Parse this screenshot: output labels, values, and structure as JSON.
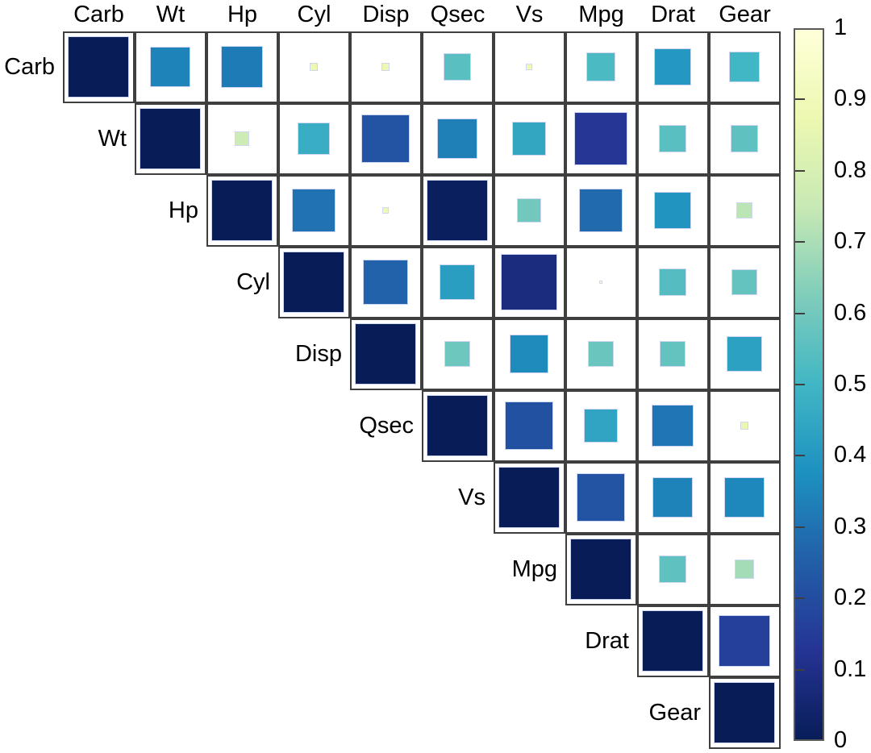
{
  "figure": {
    "type": "correlation-matrix-heatmap",
    "background": "#ffffff",
    "grid_line_color": "#3f3f3f",
    "square_border_color": "#ced7ef"
  },
  "chart_data": {
    "type": "heatmap",
    "title": "",
    "xlabel": "",
    "ylabel": "",
    "colormap": "YlGnBu",
    "colorbar": {
      "min": 0,
      "max": 1,
      "orientation": "vertical",
      "position": "right",
      "ticks": [
        1,
        0.9,
        0.8,
        0.7,
        0.6,
        0.5,
        0.4,
        0.3,
        0.2,
        0.1,
        0
      ],
      "tick_labels": [
        "1",
        "0.9",
        "0.8",
        "0.7",
        "0.6",
        "0.5",
        "0.4",
        "0.3",
        "0.2",
        "0.1",
        "0"
      ]
    },
    "layout": "upper-triangular",
    "marker": "square-sized-by-value",
    "categories": [
      "Carb",
      "Wt",
      "Hp",
      "Cyl",
      "Disp",
      "Qsec",
      "Vs",
      "Mpg",
      "Drat",
      "Gear"
    ],
    "xtick_labels": [
      "Carb",
      "Wt",
      "Hp",
      "Cyl",
      "Disp",
      "Qsec",
      "Vs",
      "Mpg",
      "Drat",
      "Gear"
    ],
    "ytick_labels": [
      "Carb",
      "Wt",
      "Hp",
      "Cyl",
      "Disp",
      "Qsec",
      "Vs",
      "Mpg",
      "Drat",
      "Gear"
    ],
    "matrix": [
      [
        1.0,
        0.66,
        0.68,
        0.12,
        0.12,
        0.45,
        0.1,
        0.48,
        0.6,
        0.5
      ],
      [
        null,
        1.0,
        0.23,
        0.53,
        0.78,
        0.67,
        0.55,
        0.87,
        0.45,
        0.44
      ],
      [
        null,
        null,
        1.0,
        0.7,
        0.11,
        0.99,
        0.4,
        0.72,
        0.61,
        0.27
      ],
      [
        null,
        null,
        null,
        1.0,
        0.74,
        0.58,
        0.92,
        0.06,
        0.46,
        0.43
      ],
      [
        null,
        null,
        null,
        null,
        1.0,
        0.41,
        0.64,
        0.42,
        0.43,
        0.57
      ],
      [
        null,
        null,
        null,
        null,
        null,
        1.0,
        0.79,
        0.56,
        0.69,
        0.13
      ],
      [
        null,
        null,
        null,
        null,
        null,
        null,
        1.0,
        0.78,
        0.66,
        0.65
      ],
      [
        null,
        null,
        null,
        null,
        null,
        null,
        null,
        1.0,
        0.44,
        0.31
      ],
      [
        null,
        null,
        null,
        null,
        null,
        null,
        null,
        null,
        1.0,
        0.84
      ],
      [
        null,
        null,
        null,
        null,
        null,
        null,
        null,
        null,
        null,
        1.0
      ]
    ]
  }
}
